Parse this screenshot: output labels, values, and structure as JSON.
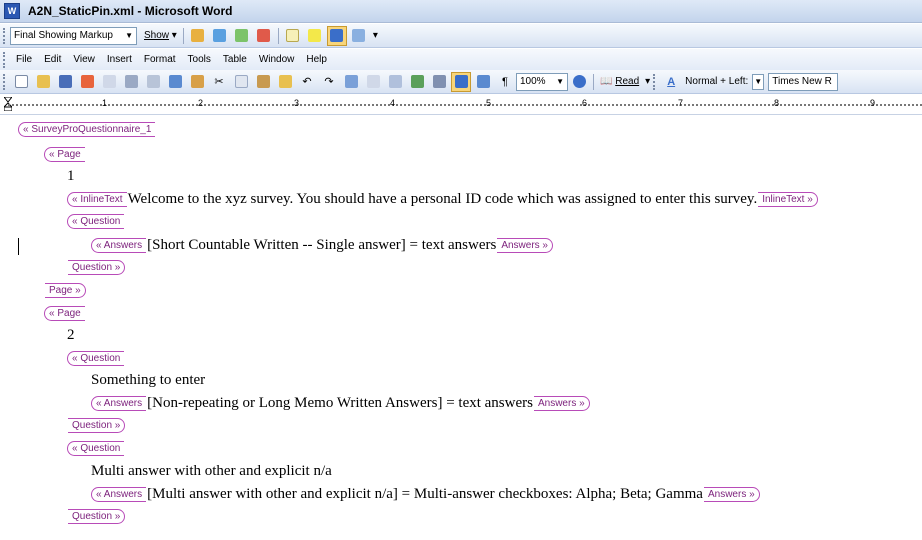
{
  "window": {
    "title": "A2N_StaticPin.xml - Microsoft Word",
    "icon": "word-document-icon",
    "icon_letter": "W"
  },
  "reviewing_toolbar": {
    "display_mode": "Final Showing Markup",
    "show_label": "Show"
  },
  "menu": [
    "File",
    "Edit",
    "View",
    "Insert",
    "Format",
    "Tools",
    "Table",
    "Window",
    "Help"
  ],
  "standard_toolbar": {
    "zoom": "100%",
    "read_label": "Read",
    "style_value": "Normal + Left:",
    "font_value": "Times New R"
  },
  "ruler": {
    "numbers": [
      "1",
      "2",
      "3",
      "4",
      "5",
      "6",
      "7",
      "8",
      "9"
    ]
  },
  "document": {
    "lines": [
      {
        "open": "SurveyProQuestionnaire_1",
        "text": "",
        "close": ""
      },
      {
        "open": "Page",
        "text": "",
        "close": ""
      },
      {
        "open": "",
        "text": "1",
        "close": ""
      },
      {
        "open": "InlineText",
        "text": "Welcome to the xyz survey.  You should have a personal ID code which was assigned to enter this survey.",
        "close": "InlineText"
      },
      {
        "open": "Question",
        "text": "",
        "close": ""
      },
      {
        "open": "Answers",
        "text": "[Short Countable Written -- Single answer] = text answers",
        "close": "Answers"
      },
      {
        "open": "",
        "text": "",
        "close": "Question"
      },
      {
        "open": "",
        "text": "",
        "close": "Page"
      },
      {
        "open": "Page",
        "text": "",
        "close": ""
      },
      {
        "open": "",
        "text": "2",
        "close": ""
      },
      {
        "open": "Question",
        "text": "",
        "close": ""
      },
      {
        "open": "",
        "text": "Something to enter",
        "close": ""
      },
      {
        "open": "Answers",
        "text": "[Non-repeating or Long Memo Written Answers] = text answers",
        "close": "Answers"
      },
      {
        "open": "",
        "text": "",
        "close": "Question"
      },
      {
        "open": "Question",
        "text": "",
        "close": ""
      },
      {
        "open": "",
        "text": "Multi answer with other and explicit n/a",
        "close": ""
      },
      {
        "open": "Answers",
        "text": "[Multi answer with other and explicit n/a] = Multi-answer checkboxes: Alpha; Beta; Gamma",
        "close": "Answers"
      },
      {
        "open": "",
        "text": "",
        "close": "Question"
      }
    ]
  },
  "colors": {
    "xml_tag": "#b84bb8",
    "titlebar": "#c3d4ec"
  }
}
